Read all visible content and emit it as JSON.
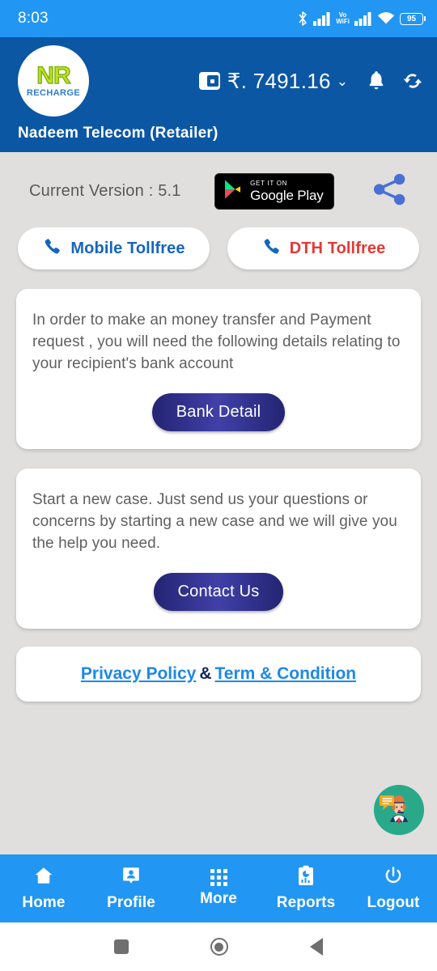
{
  "status_bar": {
    "time": "8:03",
    "vowifi_top": "Vo",
    "vowifi_bottom": "WiFi",
    "battery_percent": "95",
    "icons": [
      "bluetooth-icon",
      "signal-bars-icon",
      "vowifi-icon",
      "signal-bars-2-icon",
      "wifi-icon",
      "battery-icon"
    ]
  },
  "header": {
    "logo_primary": "NR",
    "logo_secondary": "RECHARGE",
    "balance": "₹. 7491.16",
    "dropdown_chevron": "⌄",
    "retailer_name": "Nadeem Telecom (Retailer)",
    "icons": [
      "wallet-icon",
      "chevron-down-icon",
      "bell-icon",
      "refresh-icon"
    ],
    "bg_color": "#0b57a4"
  },
  "version": {
    "label": "Current Version : 5.1",
    "play_badge_top": "GET IT ON",
    "play_badge_bottom": "Google Play",
    "share_icon": "share-icon"
  },
  "tollfree": {
    "mobile_label": "Mobile Tollfree",
    "mobile_color": "#1565c0",
    "dth_label": "DTH Tollfree",
    "dth_color": "#e53935",
    "phone_icon_color": "#1565c0"
  },
  "cards": [
    {
      "text": "In order to make an money transfer and Payment request , you will need the following details relating to your recipient's bank account",
      "button_label": "Bank Detail"
    },
    {
      "text": "Start a new case. Just send us your questions or concerns by starting a new case and we will give you the help you need.",
      "button_label": "Contact Us"
    }
  ],
  "links": {
    "privacy": "Privacy Policy",
    "separator": "&",
    "terms": "Term & Condition",
    "link_color": "#1e88e5"
  },
  "support": {
    "fab_icon": "support-agent-avatar",
    "bg_color": "#2aa98a"
  },
  "bottom_nav": {
    "bg_color": "#2196f3",
    "items": [
      {
        "label": "Home",
        "icon": "home-icon"
      },
      {
        "label": "Profile",
        "icon": "profile-icon"
      },
      {
        "label": "More",
        "icon": "grid-icon"
      },
      {
        "label": "Reports",
        "icon": "reports-clipboard-icon"
      },
      {
        "label": "Logout",
        "icon": "power-icon"
      }
    ]
  },
  "android_nav": {
    "recents": "recents-square-icon",
    "home": "home-circle-icon",
    "back": "back-triangle-icon"
  }
}
